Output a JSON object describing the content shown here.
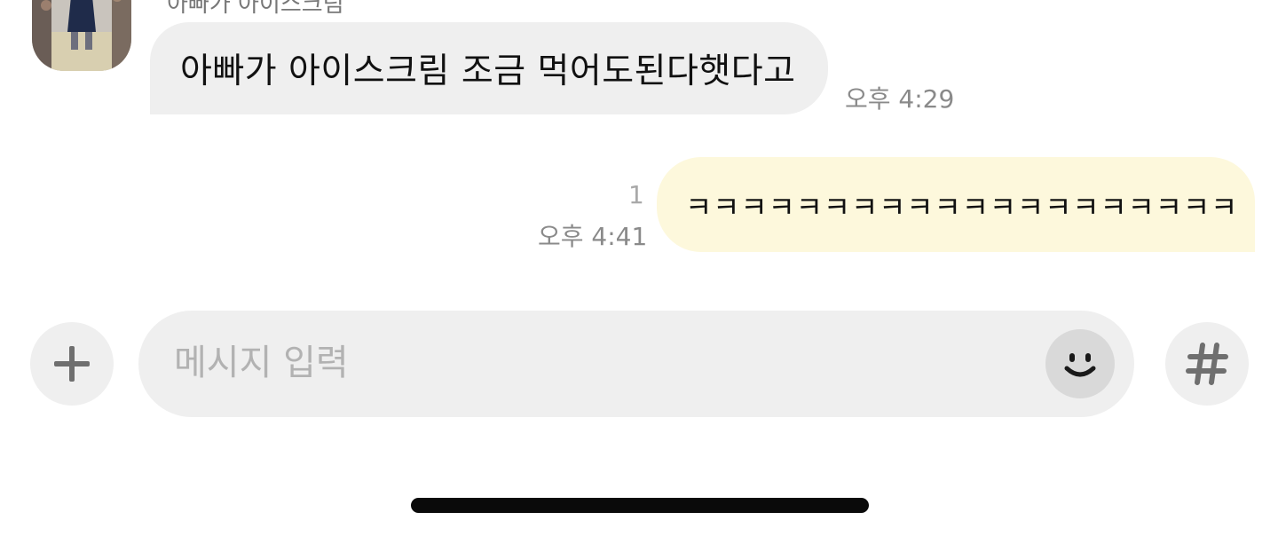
{
  "incoming": {
    "sender_name": "아빠가 아이스크림",
    "message": "아빠가 아이스크림 조금 먹어도된다햇다고",
    "time": "오후 4:29"
  },
  "outgoing": {
    "message": "ㅋㅋㅋㅋㅋㅋㅋㅋㅋㅋㅋㅋㅋㅋㅋㅋㅋㅋㅋㅋ",
    "unread_count": "1",
    "time": "오후 4:41"
  },
  "composer": {
    "placeholder": "메시지 입력",
    "value": "",
    "plus_icon": "plus-icon",
    "emoji_icon": "smile-icon",
    "hash_icon": "hash-icon"
  },
  "colors": {
    "incoming_bubble": "#efefef",
    "outgoing_bubble": "#fdf8dc",
    "timestamp": "#8a8a8a"
  }
}
